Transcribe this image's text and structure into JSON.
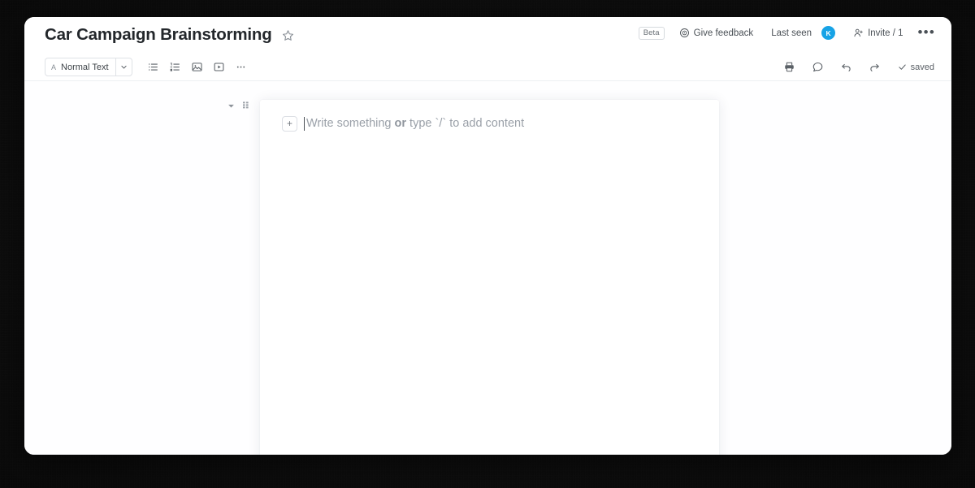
{
  "header": {
    "doc_title": "Car Campaign Brainstorming",
    "star_icon": "star-outline-icon",
    "beta_label": "Beta",
    "feedback_label": "Give feedback",
    "feedback_icon": "megaphone-circle-icon",
    "last_seen_label": "Last seen",
    "avatar_initial": "K",
    "avatar_color": "#17a3e6",
    "invite_label": "Invite / 1",
    "invite_icon": "person-add-icon",
    "more_label": "•••"
  },
  "toolbar": {
    "style_select": {
      "a_glyph": "A",
      "value": "Normal Text",
      "caret_icon": "chevron-down-icon"
    },
    "buttons": [
      {
        "name": "bulleted-list",
        "icon": "bulleted-list-icon"
      },
      {
        "name": "numbered-list",
        "icon": "numbered-list-icon"
      },
      {
        "name": "insert-image",
        "icon": "image-icon"
      },
      {
        "name": "insert-video",
        "icon": "video-icon"
      },
      {
        "name": "more-options",
        "icon": "ellipsis-icon"
      }
    ],
    "right": {
      "print_icon": "printer-icon",
      "comment_icon": "comment-bubble-icon",
      "undo_icon": "undo-arrow-icon",
      "redo_icon": "redo-arrow-icon",
      "saved_label": "saved",
      "saved_check_icon": "check-icon"
    }
  },
  "editor": {
    "gutter": {
      "caret_icon": "triangle-down-icon",
      "drag_handle_icon": "drag-handle-icon"
    },
    "add_block_label": "+",
    "placeholder": {
      "part1": "Write something ",
      "bold": "or",
      "part2": " type `/` to add content"
    }
  }
}
